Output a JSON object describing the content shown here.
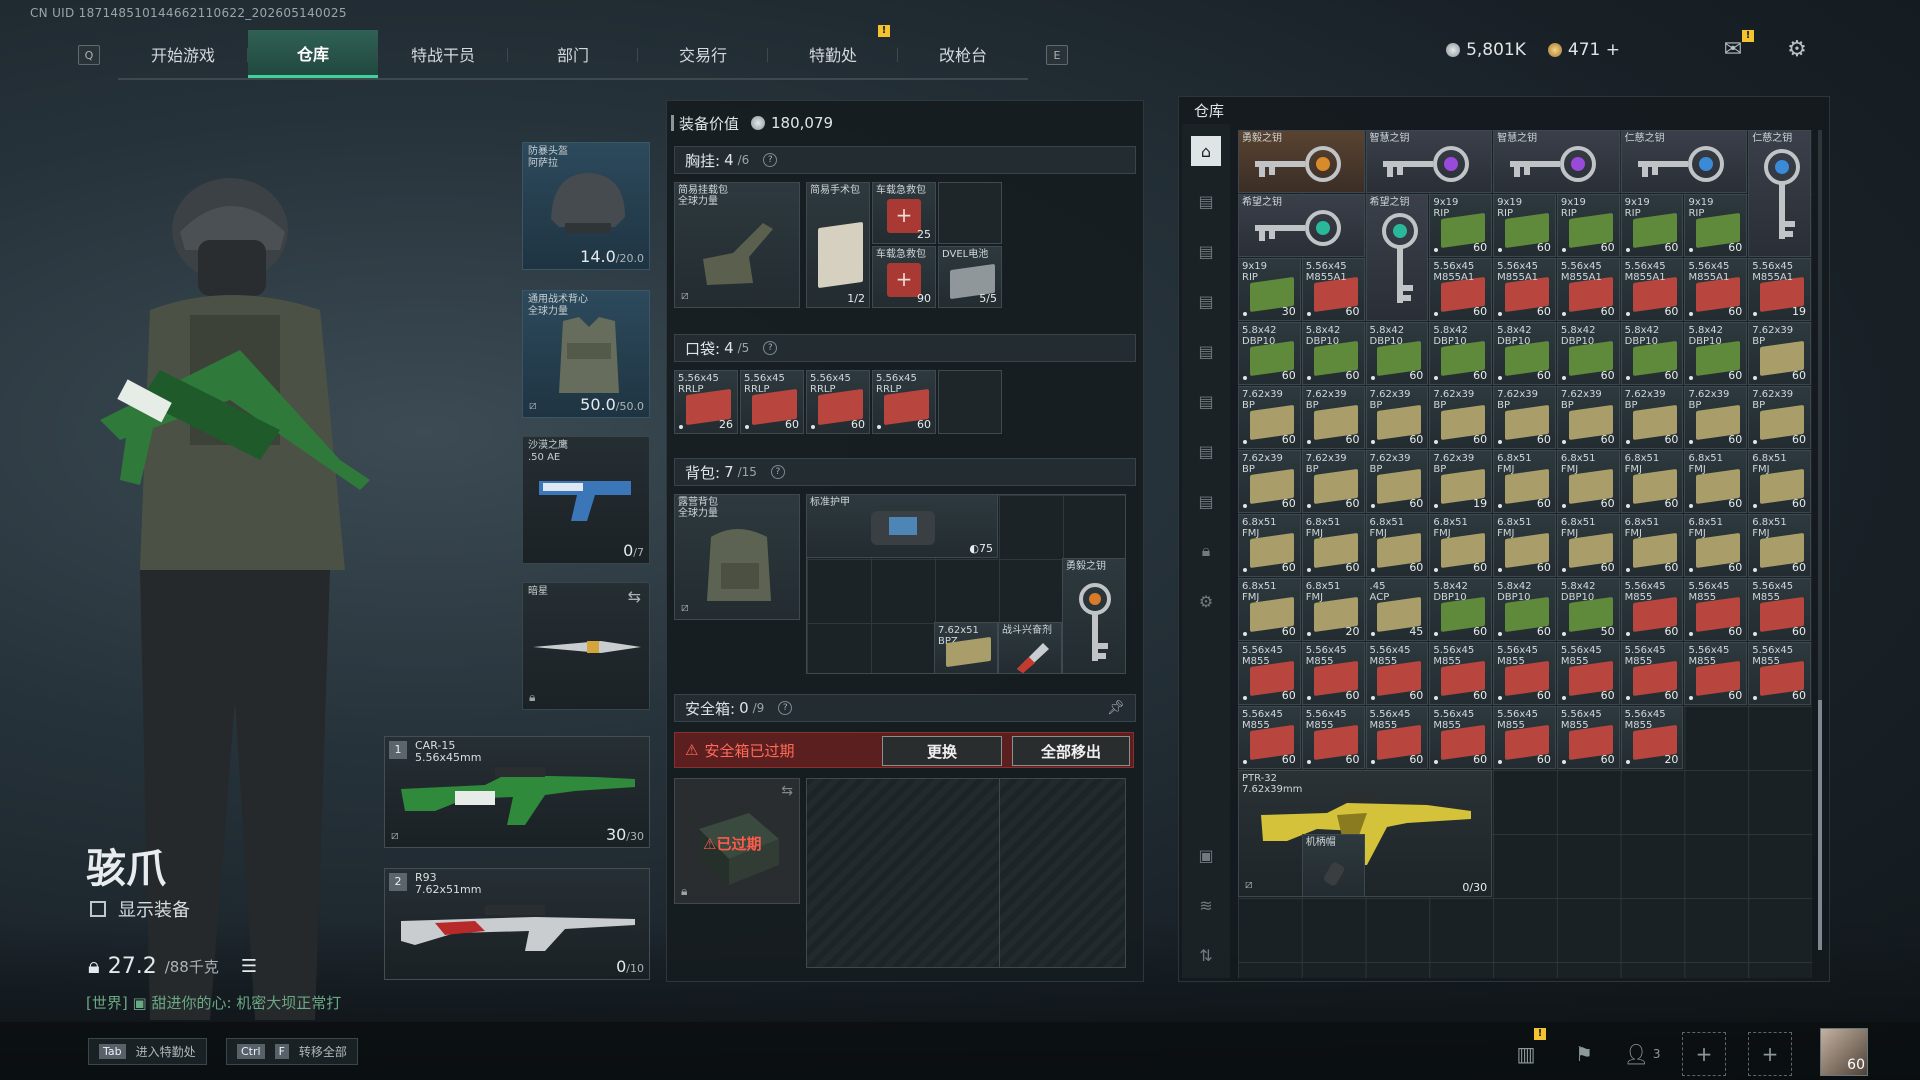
{
  "uid": "CN UID 187148510144662110622_202605140025",
  "nav": {
    "left_key": "Q",
    "right_key": "E",
    "tabs": [
      {
        "label": "开始游戏"
      },
      {
        "label": "仓库",
        "active": true
      },
      {
        "label": "特战干员"
      },
      {
        "label": "部门"
      },
      {
        "label": "交易行"
      },
      {
        "label": "特勤处",
        "badge": "!"
      },
      {
        "label": "改枪台"
      }
    ]
  },
  "currency": {
    "silver": "5,801K",
    "gold": "471",
    "add": "+"
  },
  "top_icons": {
    "mail_badge": "!"
  },
  "character": {
    "name": "骇爪",
    "show_equipment": "显示装备",
    "weight": "27.2",
    "weight_max": "/88千克",
    "chat_channel": "[世界]",
    "chat_text": "甜进你的心: 机密大坝正常打"
  },
  "bottom": {
    "keys": [
      {
        "key": "Tab",
        "label": "进入特勤处"
      },
      {
        "key1": "Ctrl",
        "key2": "F",
        "label": "转移全部"
      }
    ],
    "squad_count": "3",
    "badge": "!",
    "level": "60"
  },
  "equip": {
    "helmet": {
      "label": "防暴头盔\n阿萨拉",
      "value": "14.0",
      "max": "/20.0"
    },
    "armor": {
      "label": "通用战术背心\n全球力量",
      "value": "50.0",
      "max": "/50.0"
    },
    "pistol": {
      "label": "沙漠之鹰\n.50 AE",
      "value": "0",
      "max": "/7"
    },
    "melee": {
      "label": "暗星"
    },
    "primary": {
      "num": "1",
      "name": "CAR-15",
      "cal": "5.56x45mm",
      "value": "30",
      "max": "/30"
    },
    "secondary": {
      "num": "2",
      "name": "R93",
      "cal": "7.62x51mm",
      "value": "0",
      "max": "/10"
    }
  },
  "loadout": {
    "title": "装备价值",
    "value": "180,079",
    "chest": {
      "label": "胸挂:",
      "count": "4",
      "max": "/6",
      "rig": "简易挂载包\n全球力量",
      "items": [
        {
          "label": "简易手术包",
          "count": "1/2"
        },
        {
          "label": "车载急救包",
          "count": "25"
        },
        {
          "label": "车载急救包",
          "count": "90"
        },
        {
          "label": "DVEL电池",
          "count": "5/5"
        }
      ]
    },
    "pocket": {
      "label": "口袋:",
      "count": "4",
      "max": "/5",
      "items": [
        {
          "label": "5.56x45\nRRLP",
          "count": "26"
        },
        {
          "label": "5.56x45\nRRLP",
          "count": "60"
        },
        {
          "label": "5.56x45\nRRLP",
          "count": "60"
        },
        {
          "label": "5.56x45\nRRLP",
          "count": "60"
        }
      ]
    },
    "backpack": {
      "label": "背包:",
      "count": "7",
      "max": "/15",
      "bag": "露营背包\n全球力量",
      "items": [
        {
          "label": "标准护甲",
          "count": "75"
        },
        {
          "label": "勇毅之钥"
        },
        {
          "label": "7.62x51\nBPZ"
        },
        {
          "label": "战斗兴奋剂"
        }
      ]
    },
    "safe": {
      "label": "安全箱:",
      "count": "0",
      "max": "/9",
      "expired_text": "安全箱已过期",
      "swap": "更换",
      "moveall": "全部移出",
      "overlay": "已过期"
    }
  },
  "warehouse": {
    "title": "仓库",
    "items": [
      {
        "label": "勇毅之钥",
        "kind": "key"
      },
      {
        "label": "智慧之钥",
        "kind": "key"
      },
      {
        "label": "智慧之钥",
        "kind": "key"
      },
      {
        "label": "仁慈之钥",
        "kind": "key"
      },
      {
        "label": "仁慈之钥",
        "kind": "key"
      },
      {
        "label": "希望之钥",
        "kind": "key"
      },
      {
        "label": "希望之钥",
        "kind": "key"
      },
      {
        "label": "9x19\nRIP",
        "count": "60"
      },
      {
        "label": "9x19\nRIP",
        "count": "60"
      },
      {
        "label": "9x19\nRIP",
        "count": "60"
      },
      {
        "label": "9x19\nRIP",
        "count": "60"
      },
      {
        "label": "9x19\nRIP",
        "count": "60"
      },
      {
        "label": "9x19\nRIP",
        "count": "30"
      },
      {
        "label": "5.56x45\nM855A1",
        "count": "60"
      },
      {
        "label": "5.56x45\nM855A1",
        "count": "60"
      },
      {
        "label": "5.56x45\nM855A1",
        "count": "60"
      },
      {
        "label": "5.56x45\nM855A1",
        "count": "60"
      },
      {
        "label": "5.56x45\nM855A1",
        "count": "60"
      },
      {
        "label": "5.56x45\nM855A1",
        "count": "60"
      },
      {
        "label": "5.56x45\nM855A1",
        "count": "19"
      },
      {
        "label": "5.8x42\nDBP10",
        "count": "60"
      },
      {
        "label": "5.8x42\nDBP10",
        "count": "60"
      },
      {
        "label": "5.8x42\nDBP10",
        "count": "60"
      },
      {
        "label": "5.8x42\nDBP10",
        "count": "60"
      },
      {
        "label": "5.8x42\nDBP10",
        "count": "60"
      },
      {
        "label": "5.8x42\nDBP10",
        "count": "60"
      },
      {
        "label": "5.8x42\nDBP10",
        "count": "60"
      },
      {
        "label": "5.8x42\nDBP10",
        "count": "60"
      },
      {
        "label": "7.62x39\nBP",
        "count": "60"
      },
      {
        "label": "7.62x39\nBP",
        "count": "60"
      },
      {
        "label": "7.62x39\nBP",
        "count": "60"
      },
      {
        "label": "7.62x39\nBP",
        "count": "60"
      },
      {
        "label": "7.62x39\nBP",
        "count": "60"
      },
      {
        "label": "7.62x39\nBP",
        "count": "60"
      },
      {
        "label": "7.62x39\nBP",
        "count": "60"
      },
      {
        "label": "7.62x39\nBP",
        "count": "60"
      },
      {
        "label": "7.62x39\nBP",
        "count": "60"
      },
      {
        "label": "7.62x39\nBP",
        "count": "60"
      },
      {
        "label": "7.62x39\nBP",
        "count": "60"
      },
      {
        "label": "7.62x39\nBP",
        "count": "60"
      },
      {
        "label": "7.62x39\nBP",
        "count": "60"
      },
      {
        "label": "7.62x39\nBP",
        "count": "19"
      },
      {
        "label": "6.8x51\nFMJ",
        "count": "60"
      },
      {
        "label": "6.8x51\nFMJ",
        "count": "60"
      },
      {
        "label": "6.8x51\nFMJ",
        "count": "60"
      },
      {
        "label": "6.8x51\nFMJ",
        "count": "60"
      },
      {
        "label": "6.8x51\nFMJ",
        "count": "60"
      },
      {
        "label": "6.8x51\nFMJ",
        "count": "60"
      },
      {
        "label": "6.8x51\nFMJ",
        "count": "60"
      },
      {
        "label": "6.8x51\nFMJ",
        "count": "60"
      },
      {
        "label": "6.8x51\nFMJ",
        "count": "60"
      },
      {
        "label": "6.8x51\nFMJ",
        "count": "60"
      },
      {
        "label": "6.8x51\nFMJ",
        "count": "60"
      },
      {
        "label": "6.8x51\nFMJ",
        "count": "60"
      },
      {
        "label": "6.8x51\nFMJ",
        "count": "60"
      },
      {
        "label": "6.8x51\nFMJ",
        "count": "60"
      },
      {
        "label": "6.8x51\nFMJ",
        "count": "60"
      },
      {
        "label": "6.8x51\nFMJ",
        "count": "20"
      },
      {
        "label": ".45\nACP",
        "count": "45"
      },
      {
        "label": "5.8x42\nDBP10",
        "count": "60"
      },
      {
        "label": "5.8x42\nDBP10",
        "count": "60"
      },
      {
        "label": "5.8x42\nDBP10",
        "count": "50"
      },
      {
        "label": "5.56x45\nM855",
        "count": "60"
      },
      {
        "label": "5.56x45\nM855",
        "count": "60"
      },
      {
        "label": "5.56x45\nM855",
        "count": "60"
      },
      {
        "label": "5.56x45\nM855",
        "count": "60"
      },
      {
        "label": "5.56x45\nM855",
        "count": "60"
      },
      {
        "label": "5.56x45\nM855",
        "count": "60"
      },
      {
        "label": "5.56x45\nM855",
        "count": "60"
      },
      {
        "label": "5.56x45\nM855",
        "count": "60"
      },
      {
        "label": "5.56x45\nM855",
        "count": "60"
      },
      {
        "label": "5.56x45\nM855",
        "count": "60"
      },
      {
        "label": "5.56x45\nM855",
        "count": "60"
      },
      {
        "label": "5.56x45\nM855",
        "count": "60"
      },
      {
        "label": "5.56x45\nM855",
        "count": "60"
      },
      {
        "label": "5.56x45\nM855",
        "count": "60"
      },
      {
        "label": "5.56x45\nM855",
        "count": "60"
      },
      {
        "label": "5.56x45\nM855",
        "count": "60"
      },
      {
        "label": "5.56x45\nM855",
        "count": "60"
      },
      {
        "label": "5.56x45\nM855",
        "count": "60"
      },
      {
        "label": "5.56x45\nM855",
        "count": "20"
      }
    ],
    "gun": {
      "name": "PTR-32",
      "cal": "7.62x39mm",
      "count": "0/30"
    },
    "grip": {
      "label": "机柄帽"
    }
  },
  "colors": {
    "accent": "#3fd39b",
    "danger": "#ff6a5a",
    "ammo_red": "#b8463e",
    "ammo_green": "#5f8a3c",
    "ammo_khaki": "#a99d6a",
    "key_gold": "#c98a3a"
  }
}
